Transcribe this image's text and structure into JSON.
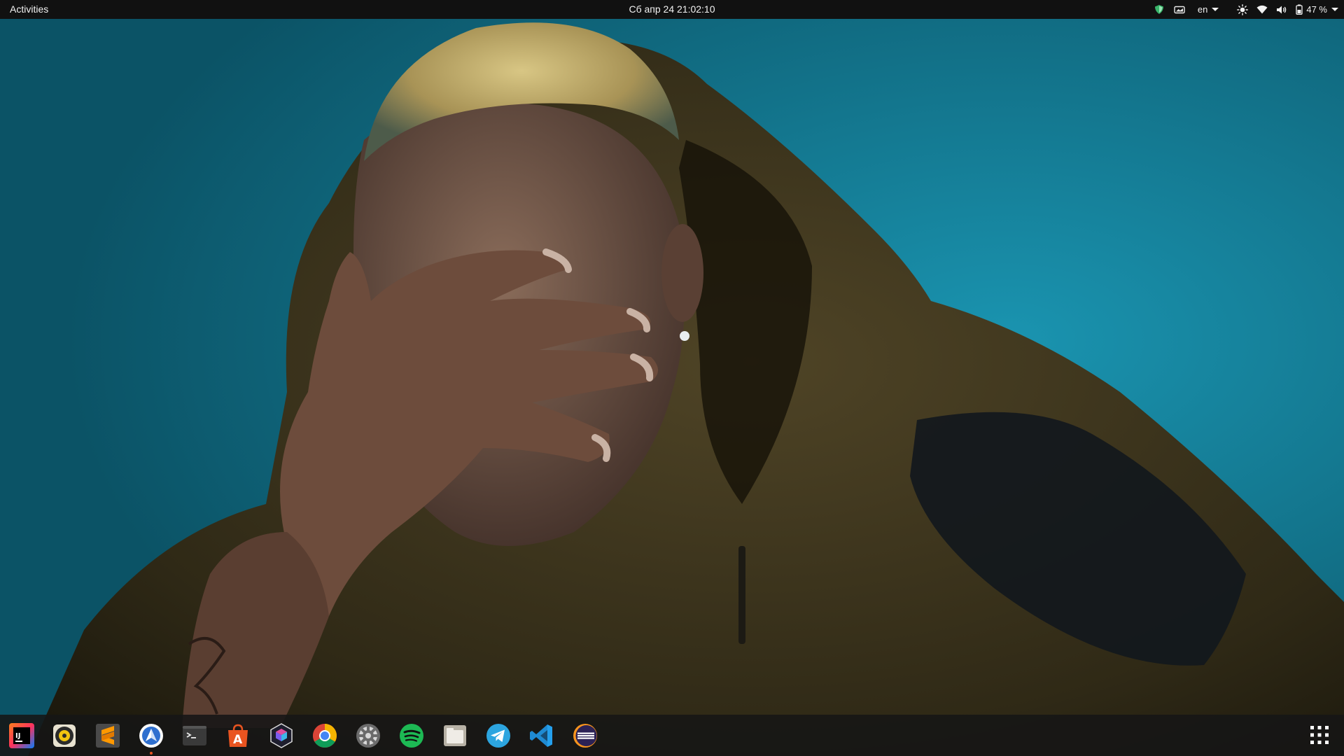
{
  "topbar": {
    "activities_label": "Activities",
    "datetime": "Сб апр 24  21:02:10",
    "tray": {
      "shield_icon": "shield-icon",
      "screen_icon": "screen-icon",
      "keyboard_layout": "en",
      "brightness_icon": "brightness-icon",
      "wifi_icon": "wifi-icon",
      "volume_icon": "volume-icon",
      "battery_icon": "battery-icon",
      "battery_percent": "47 %"
    }
  },
  "dock": {
    "apps": [
      {
        "name": "intellij-idea",
        "icon": "intellij-idea-icon",
        "running": false
      },
      {
        "name": "rhythmbox",
        "icon": "rhythmbox-icon",
        "running": false
      },
      {
        "name": "sublime-text",
        "icon": "sublime-text-icon",
        "running": false
      },
      {
        "name": "web-browser",
        "icon": "web-browser-icon",
        "running": true
      },
      {
        "name": "terminal",
        "icon": "terminal-icon",
        "running": false
      },
      {
        "name": "software-center",
        "icon": "software-center-icon",
        "running": false
      },
      {
        "name": "cube-app",
        "icon": "cube-app-icon",
        "running": false
      },
      {
        "name": "google-chrome",
        "icon": "chrome-icon",
        "running": false
      },
      {
        "name": "settings",
        "icon": "gear-icon",
        "running": false
      },
      {
        "name": "spotify",
        "icon": "spotify-icon",
        "running": false
      },
      {
        "name": "files",
        "icon": "files-icon",
        "running": false
      },
      {
        "name": "telegram",
        "icon": "telegram-icon",
        "running": false
      },
      {
        "name": "vscode",
        "icon": "vscode-icon",
        "running": false
      },
      {
        "name": "eclipse",
        "icon": "eclipse-icon",
        "running": false
      }
    ],
    "show_apps_icon": "grid-icon"
  },
  "colors": {
    "topbar_bg": "#111111",
    "dock_bg": "#161616",
    "accent": "#e95420",
    "wallpaper_teal": "#1488a2"
  }
}
